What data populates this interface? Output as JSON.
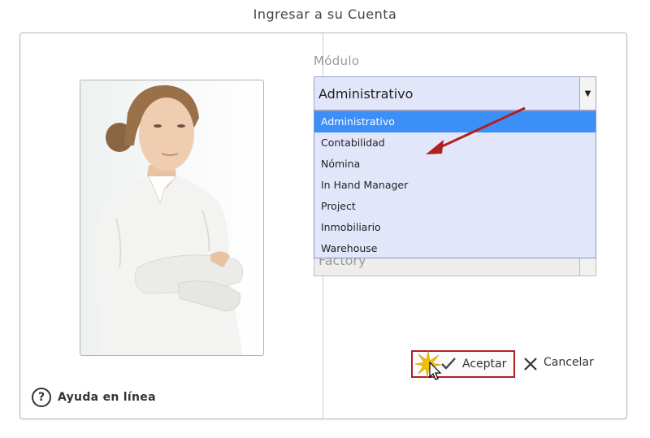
{
  "window": {
    "title": "Ingresar a su Cuenta"
  },
  "left": {
    "help": {
      "icon_text": "?",
      "label": "Ayuda en línea"
    }
  },
  "module": {
    "label": "Módulo",
    "selected": "Administrativo",
    "options": [
      "Administrativo",
      "Contabilidad",
      "Nómina",
      "In Hand Manager",
      "Project",
      "Inmobiliario",
      "Warehouse"
    ],
    "obscured_option": "Factory"
  },
  "actions": {
    "accept_label": "Aceptar",
    "cancel_label": "Cancelar"
  },
  "colors": {
    "select_bg": "#e2e6fb",
    "highlight": "#3d8ff8",
    "annotation_red": "#b02020"
  }
}
